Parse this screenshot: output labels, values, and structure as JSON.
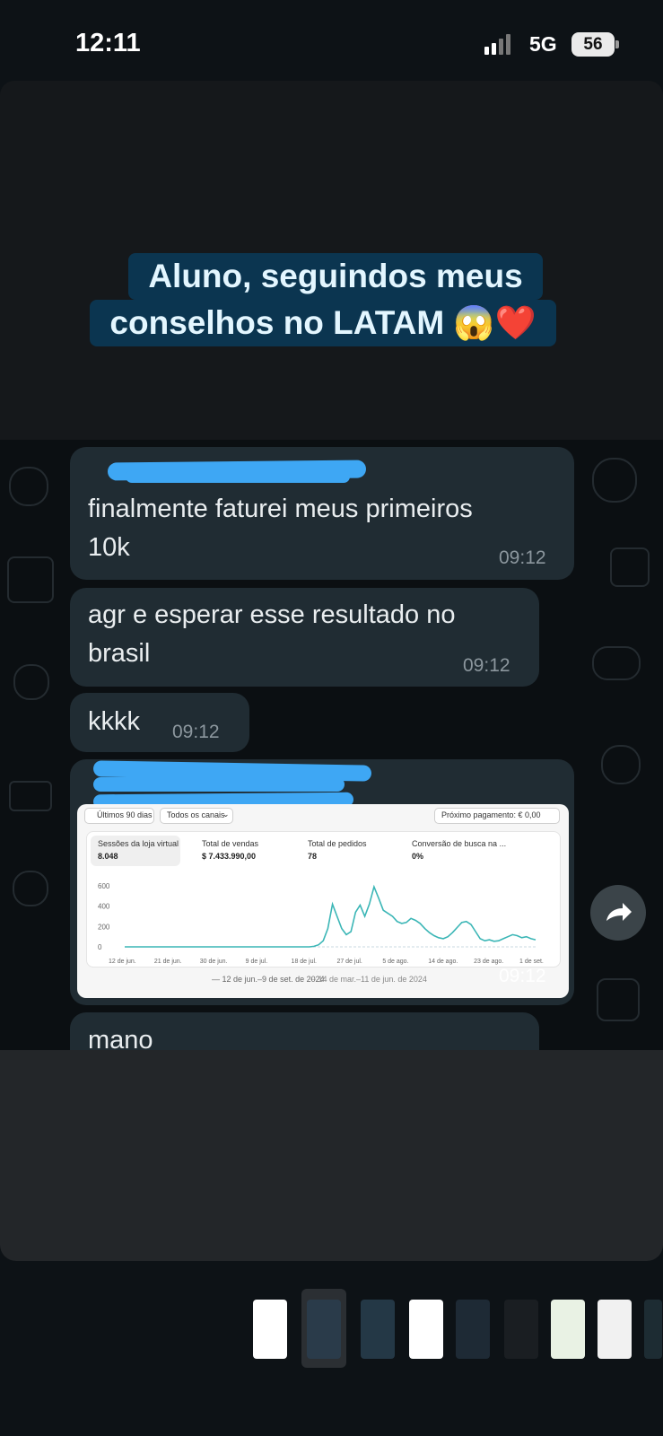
{
  "status_bar": {
    "time": "12:11",
    "network": "5G",
    "battery": "56"
  },
  "story": {
    "caption_line1": "Aluno, seguindos meus",
    "caption_line2": "conselhos  no LATAM 😱❤️"
  },
  "messages": [
    {
      "text": "finalmente faturei meus primeiros 10k",
      "line1": "finalmente faturei meus primeiros",
      "line2": "10k",
      "time": "09:12"
    },
    {
      "text": "agr e esperar esse resultado no brasil",
      "line1": "agr e esperar esse resultado no",
      "line2": "brasil",
      "time": "09:12"
    },
    {
      "text": "kkkk",
      "time": "09:12"
    },
    {
      "type": "image",
      "time": "09:12"
    },
    {
      "text": "mano"
    }
  ],
  "dashboard": {
    "date_range": "Últimos 90 dias",
    "channel": "Todos os canais",
    "payout": "Próximo pagamento: € 0,00",
    "metrics": [
      {
        "label": "Sessões da loja virtual",
        "value": "8.048"
      },
      {
        "label": "Total de vendas",
        "value": "$ 7.433.990,00"
      },
      {
        "label": "Total de pedidos",
        "value": "78"
      },
      {
        "label": "Conversão de busca na ...",
        "value": "0%"
      }
    ],
    "legend_current": "12 de jun.–9 de set. de 2024",
    "legend_previous": "14 de mar.–11 de jun. de 2024",
    "accent": "#3bb6b6"
  },
  "chart_data": {
    "type": "line",
    "title": "",
    "xlabel": "",
    "ylabel": "",
    "ylim": [
      0,
      600
    ],
    "y_ticks": [
      "600",
      "400",
      "200",
      "0"
    ],
    "x_ticks": [
      "12 de jun.",
      "21 de jun.",
      "30 de jun.",
      "9 de jul.",
      "18 de jul.",
      "27 de jul.",
      "5 de ago.",
      "14 de ago.",
      "23 de ago.",
      "1 de set."
    ],
    "series": [
      {
        "name": "12 de jun.–9 de set. de 2024",
        "values": [
          0,
          0,
          0,
          0,
          0,
          0,
          0,
          0,
          0,
          0,
          0,
          0,
          0,
          0,
          0,
          0,
          0,
          0,
          0,
          0,
          0,
          0,
          0,
          0,
          0,
          0,
          0,
          0,
          0,
          0,
          0,
          0,
          0,
          0,
          0,
          0,
          0,
          0,
          0,
          0,
          0,
          5,
          20,
          60,
          180,
          420,
          300,
          180,
          120,
          150,
          340,
          410,
          300,
          420,
          590,
          480,
          360,
          330,
          300,
          250,
          230,
          240,
          280,
          260,
          230,
          180,
          140,
          110,
          90,
          80,
          100,
          140,
          190,
          240,
          250,
          220,
          150,
          80,
          60,
          70,
          55,
          60,
          80,
          100,
          120,
          110,
          90,
          100,
          80,
          70
        ]
      },
      {
        "name": "14 de mar.–11 de jun. de 2024",
        "values": [
          0,
          0,
          0,
          0,
          0,
          0,
          0,
          0,
          0,
          0,
          0,
          0,
          0,
          0,
          0,
          0,
          0,
          0,
          0,
          0,
          0,
          0,
          0,
          0,
          0,
          0,
          0,
          0,
          0,
          0,
          0,
          0,
          0,
          0,
          0,
          0,
          0,
          0,
          0,
          0,
          0,
          0,
          0,
          0,
          0,
          0,
          0,
          0,
          0,
          0,
          0,
          0,
          0,
          0,
          0,
          0,
          0,
          0,
          0,
          0,
          0,
          0,
          0,
          0,
          0,
          0,
          0,
          0,
          0,
          0,
          0,
          0,
          0,
          0,
          0,
          0,
          0,
          0,
          0,
          0,
          0,
          0,
          0,
          0,
          0,
          0,
          0,
          0,
          0,
          0
        ]
      }
    ],
    "grid": false,
    "legend": "bottom"
  },
  "thumb_colors": [
    "#ffffff",
    "#2a3b4a",
    "#243846",
    "#ffffff",
    "#1e2a35",
    "#1a1e22",
    "#e9f2e4",
    "#f1f1f1",
    "#1d2c33"
  ]
}
